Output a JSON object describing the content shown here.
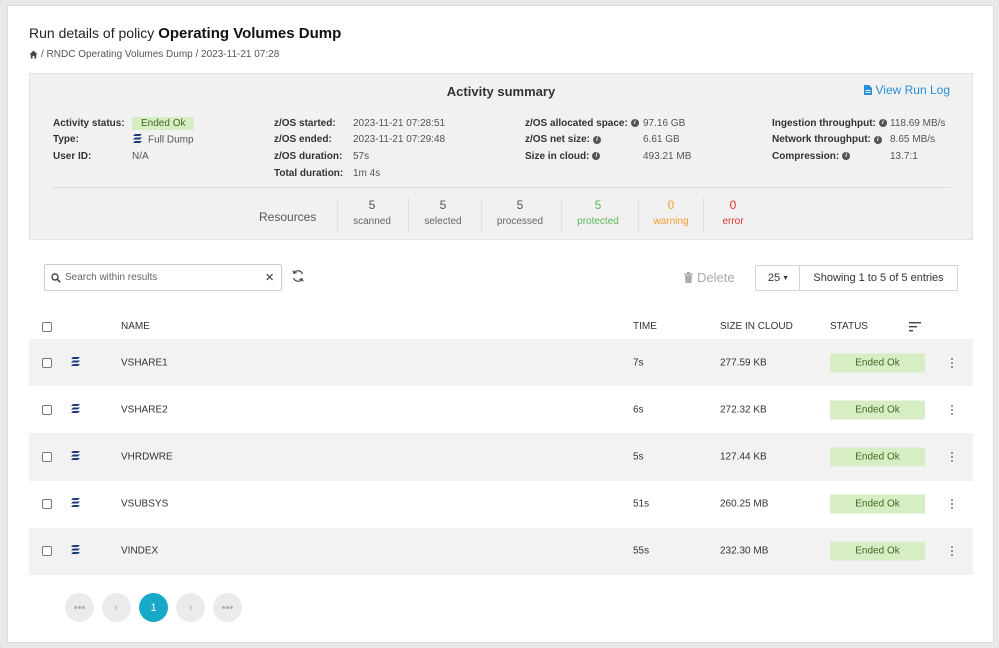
{
  "header": {
    "title_prefix": "Run details of policy",
    "title_policy": "Operating Volumes Dump",
    "breadcrumb": "/ RNDC Operating Volumes Dump / 2023-11-21 07:28"
  },
  "summary": {
    "title": "Activity summary",
    "view_run_log": "View Run Log",
    "col1": {
      "status_label": "Activity status:",
      "status_value": "Ended Ok",
      "type_label": "Type:",
      "type_value": "Full Dump",
      "user_label": "User ID:",
      "user_value": "N/A"
    },
    "col2": {
      "started_label": "z/OS started:",
      "started_value": "2023-11-21 07:28:51",
      "ended_label": "z/OS ended:",
      "ended_value": "2023-11-21 07:29:48",
      "duration_label": "z/OS duration:",
      "duration_value": "57s",
      "total_label": "Total duration:",
      "total_value": "1m 4s"
    },
    "col3": {
      "alloc_label": "z/OS allocated space:",
      "alloc_value": "97.16 GB",
      "net_label": "z/OS net size:",
      "net_value": "6.61 GB",
      "cloud_label": "Size in cloud:",
      "cloud_value": "493.21 MB"
    },
    "col4": {
      "ingest_label": "Ingestion throughput:",
      "ingest_value": "118.69 MB/s",
      "network_label": "Network throughput:",
      "network_value": "8.65 MB/s",
      "compression_label": "Compression:",
      "compression_value": "13.7:1"
    },
    "resources": {
      "label": "Resources",
      "items": [
        {
          "count": "5",
          "label": "scanned"
        },
        {
          "count": "5",
          "label": "selected"
        },
        {
          "count": "5",
          "label": "processed"
        },
        {
          "count": "5",
          "label": "protected"
        },
        {
          "count": "0",
          "label": "warning"
        },
        {
          "count": "0",
          "label": "error"
        }
      ]
    }
  },
  "toolbar": {
    "search_placeholder": "Search within results",
    "delete_label": "Delete",
    "page_size": "25",
    "showing": "Showing 1 to 5 of 5 entries"
  },
  "table": {
    "headers": {
      "name": "NAME",
      "time": "TIME",
      "size": "SIZE IN CLOUD",
      "status": "STATUS"
    },
    "rows": [
      {
        "name": "VSHARE1",
        "time": "7s",
        "size": "277.59 KB",
        "status": "Ended Ok"
      },
      {
        "name": "VSHARE2",
        "time": "6s",
        "size": "272.32 KB",
        "status": "Ended Ok"
      },
      {
        "name": "VHRDWRE",
        "time": "5s",
        "size": "127.44 KB",
        "status": "Ended Ok"
      },
      {
        "name": "VSUBSYS",
        "time": "51s",
        "size": "260.25 MB",
        "status": "Ended Ok"
      },
      {
        "name": "VINDEX",
        "time": "55s",
        "size": "232.30 MB",
        "status": "Ended Ok"
      }
    ]
  },
  "pagination": {
    "current": "1"
  },
  "colors": {
    "accent": "#16a9c8",
    "link": "#2a8fd8",
    "ok_bg": "#d7edc4",
    "protected": "#5cb85c",
    "warning": "#f0a030",
    "error": "#d9342b"
  }
}
